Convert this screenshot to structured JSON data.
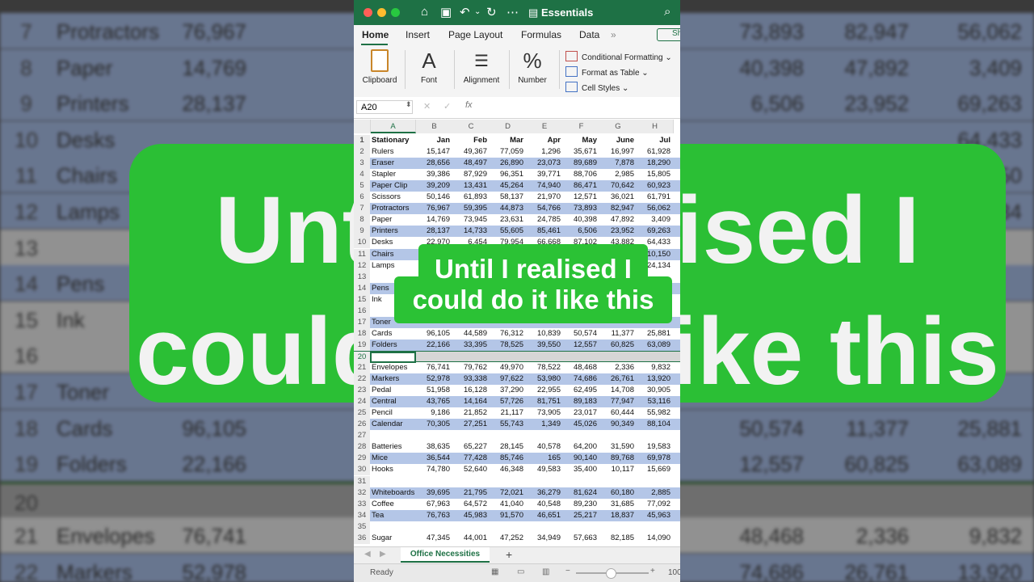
{
  "background": {
    "rows": [
      {
        "num": "7",
        "name": "Protractors",
        "v1": "76,967",
        "v2": "73,893",
        "v3": "82,947",
        "v4": "56,062",
        "style": "alt"
      },
      {
        "num": "8",
        "name": "Paper",
        "v1": "14,769",
        "v2": "40,398",
        "v3": "47,892",
        "v4": "3,409",
        "style": "alt"
      },
      {
        "num": "9",
        "name": "Printers",
        "v1": "28,137",
        "v2": "6,506",
        "v3": "23,952",
        "v4": "69,263",
        "style": "alt"
      },
      {
        "num": "10",
        "name": "Desks",
        "v1": "",
        "v2": "",
        "v3": "",
        "v4": "64,433",
        "style": "alt"
      },
      {
        "num": "11",
        "name": "Chairs",
        "v1": "",
        "v2": "",
        "v3": "",
        "v4": "10,150",
        "style": "alt"
      },
      {
        "num": "12",
        "name": "Lamps",
        "v1": "",
        "v2": "",
        "v3": "",
        "v4": "24,134",
        "style": "alt"
      },
      {
        "num": "13",
        "name": "",
        "v1": "",
        "v2": "",
        "v3": "",
        "v4": "",
        "style": "plain"
      },
      {
        "num": "14",
        "name": "Pens",
        "v1": "",
        "v2": "",
        "v3": "",
        "v4": "",
        "style": "alt"
      },
      {
        "num": "15",
        "name": "Ink",
        "v1": "",
        "v2": "",
        "v3": "",
        "v4": "",
        "style": "plain"
      },
      {
        "num": "16",
        "name": "",
        "v1": "",
        "v2": "",
        "v3": "",
        "v4": "",
        "style": "plain"
      },
      {
        "num": "17",
        "name": "Toner",
        "v1": "",
        "v2": "",
        "v3": "",
        "v4": "",
        "style": "alt"
      },
      {
        "num": "18",
        "name": "Cards",
        "v1": "96,105",
        "v2": "50,574",
        "v3": "11,377",
        "v4": "25,881",
        "style": "alt"
      },
      {
        "num": "19",
        "name": "Folders",
        "v1": "22,166",
        "v2": "12,557",
        "v3": "60,825",
        "v4": "63,089",
        "style": "alt"
      },
      {
        "num": "20",
        "name": "",
        "v1": "",
        "v2": "",
        "v3": "",
        "v4": "",
        "style": "sel"
      },
      {
        "num": "21",
        "name": "Envelopes",
        "v1": "76,741",
        "v2": "48,468",
        "v3": "2,336",
        "v4": "9,832",
        "style": "plain"
      },
      {
        "num": "22",
        "name": "Markers",
        "v1": "52,978",
        "v2": "74,686",
        "v3": "26,761",
        "v4": "13,920",
        "style": "alt"
      }
    ],
    "banner_text": "Until I realised I could do it like this"
  },
  "titlebar": {
    "title": "Essentials",
    "dot_colors": [
      "#ff5f57",
      "#febc2e",
      "#28c840"
    ]
  },
  "tabs": {
    "home": "Home",
    "insert": "Insert",
    "page_layout": "Page Layout",
    "formulas": "Formulas",
    "data": "Data",
    "more": "»",
    "share": "Sh"
  },
  "ribbon": {
    "clipboard": "Clipboard",
    "font": "Font",
    "alignment": "Alignment",
    "number": "Number",
    "conditional_formatting": "Conditional Formatting",
    "format_as_table": "Format as Table",
    "cell_styles": "Cell Styles"
  },
  "formula_bar": {
    "name_box": "A20",
    "fx": "fx"
  },
  "sheet": {
    "columns": [
      "A",
      "B",
      "C",
      "D",
      "E",
      "F",
      "G",
      "H"
    ],
    "rows": [
      {
        "n": "1",
        "cells": [
          "Stationary",
          "Jan",
          "Feb",
          "Mar",
          "Apr",
          "May",
          "June",
          "Jul"
        ],
        "style": "head"
      },
      {
        "n": "2",
        "cells": [
          "Rulers",
          "15,147",
          "49,367",
          "77,059",
          "1,296",
          "35,671",
          "16,997",
          "61,928"
        ],
        "style": "plain"
      },
      {
        "n": "3",
        "cells": [
          "Eraser",
          "28,656",
          "48,497",
          "26,890",
          "23,073",
          "89,689",
          "7,878",
          "18,290"
        ],
        "style": "band"
      },
      {
        "n": "4",
        "cells": [
          "Stapler",
          "39,386",
          "87,929",
          "96,351",
          "39,771",
          "88,706",
          "2,985",
          "15,805"
        ],
        "style": "plain"
      },
      {
        "n": "5",
        "cells": [
          "Paper Clip",
          "39,209",
          "13,431",
          "45,264",
          "74,940",
          "86,471",
          "70,642",
          "60,923"
        ],
        "style": "band"
      },
      {
        "n": "6",
        "cells": [
          "Scissors",
          "50,146",
          "61,893",
          "58,137",
          "21,970",
          "12,571",
          "36,021",
          "61,791"
        ],
        "style": "plain"
      },
      {
        "n": "7",
        "cells": [
          "Protractors",
          "76,967",
          "59,395",
          "44,873",
          "54,766",
          "73,893",
          "82,947",
          "56,062"
        ],
        "style": "band"
      },
      {
        "n": "8",
        "cells": [
          "Paper",
          "14,769",
          "73,945",
          "23,631",
          "24,785",
          "40,398",
          "47,892",
          "3,409"
        ],
        "style": "plain"
      },
      {
        "n": "9",
        "cells": [
          "Printers",
          "28,137",
          "14,733",
          "55,605",
          "85,461",
          "6,506",
          "23,952",
          "69,263"
        ],
        "style": "band"
      },
      {
        "n": "10",
        "cells": [
          "Desks",
          "22,970",
          "6,454",
          "79,954",
          "66,668",
          "87,102",
          "43,882",
          "64,433"
        ],
        "style": "plain"
      },
      {
        "n": "11",
        "cells": [
          "Chairs",
          "",
          "",
          "",
          "",
          "",
          "",
          "10,150"
        ],
        "style": "band"
      },
      {
        "n": "12",
        "cells": [
          "Lamps",
          "",
          "",
          "",
          "",
          "",
          "",
          "24,134"
        ],
        "style": "plain"
      },
      {
        "n": "13",
        "cells": [
          "",
          "",
          "",
          "",
          "",
          "",
          "",
          ""
        ],
        "style": "plain"
      },
      {
        "n": "14",
        "cells": [
          "Pens",
          "",
          "",
          "",
          "",
          "",
          "",
          ""
        ],
        "style": "band"
      },
      {
        "n": "15",
        "cells": [
          "Ink",
          "",
          "",
          "",
          "",
          "",
          "",
          ""
        ],
        "style": "plain"
      },
      {
        "n": "16",
        "cells": [
          "",
          "",
          "",
          "",
          "",
          "",
          "",
          ""
        ],
        "style": "plain"
      },
      {
        "n": "17",
        "cells": [
          "Toner",
          "",
          "",
          "",
          "",
          "",
          "",
          ""
        ],
        "style": "band"
      },
      {
        "n": "18",
        "cells": [
          "Cards",
          "96,105",
          "44,589",
          "76,312",
          "10,839",
          "50,574",
          "11,377",
          "25,881"
        ],
        "style": "plain"
      },
      {
        "n": "19",
        "cells": [
          "Folders",
          "22,166",
          "33,395",
          "78,525",
          "39,550",
          "12,557",
          "60,825",
          "63,089"
        ],
        "style": "band"
      },
      {
        "n": "20",
        "cells": [
          "",
          "",
          "",
          "",
          "",
          "",
          "",
          ""
        ],
        "style": "sel"
      },
      {
        "n": "21",
        "cells": [
          "Envelopes",
          "76,741",
          "79,762",
          "49,970",
          "78,522",
          "48,468",
          "2,336",
          "9,832"
        ],
        "style": "plain"
      },
      {
        "n": "22",
        "cells": [
          "Markers",
          "52,978",
          "93,338",
          "97,622",
          "53,980",
          "74,686",
          "26,761",
          "13,920"
        ],
        "style": "band"
      },
      {
        "n": "23",
        "cells": [
          "Pedal",
          "51,958",
          "16,128",
          "37,290",
          "22,955",
          "62,495",
          "14,708",
          "30,905"
        ],
        "style": "plain"
      },
      {
        "n": "24",
        "cells": [
          "Central",
          "43,765",
          "14,164",
          "57,726",
          "81,751",
          "89,183",
          "77,947",
          "53,116"
        ],
        "style": "band"
      },
      {
        "n": "25",
        "cells": [
          "Pencil",
          "9,186",
          "21,852",
          "21,117",
          "73,905",
          "23,017",
          "60,444",
          "55,982"
        ],
        "style": "plain"
      },
      {
        "n": "26",
        "cells": [
          "Calendar",
          "70,305",
          "27,251",
          "55,743",
          "1,349",
          "45,026",
          "90,349",
          "88,104"
        ],
        "style": "band"
      },
      {
        "n": "27",
        "cells": [
          "",
          "",
          "",
          "",
          "",
          "",
          "",
          ""
        ],
        "style": "plain"
      },
      {
        "n": "28",
        "cells": [
          "Batteries",
          "38,635",
          "65,227",
          "28,145",
          "40,578",
          "64,200",
          "31,590",
          "19,583"
        ],
        "style": "plain"
      },
      {
        "n": "29",
        "cells": [
          "Mice",
          "36,544",
          "77,428",
          "85,746",
          "165",
          "90,140",
          "89,768",
          "69,978"
        ],
        "style": "band"
      },
      {
        "n": "30",
        "cells": [
          "Hooks",
          "74,780",
          "52,640",
          "46,348",
          "49,583",
          "35,400",
          "10,117",
          "15,669"
        ],
        "style": "plain"
      },
      {
        "n": "31",
        "cells": [
          "",
          "",
          "",
          "",
          "",
          "",
          "",
          ""
        ],
        "style": "plain"
      },
      {
        "n": "32",
        "cells": [
          "Whiteboards",
          "39,695",
          "21,795",
          "72,021",
          "36,279",
          "81,624",
          "60,180",
          "2,885"
        ],
        "style": "band"
      },
      {
        "n": "33",
        "cells": [
          "Coffee",
          "67,963",
          "64,572",
          "41,040",
          "40,548",
          "89,230",
          "31,685",
          "77,092"
        ],
        "style": "plain"
      },
      {
        "n": "34",
        "cells": [
          "Tea",
          "76,763",
          "45,983",
          "91,570",
          "46,651",
          "25,217",
          "18,837",
          "45,963"
        ],
        "style": "band"
      },
      {
        "n": "35",
        "cells": [
          "",
          "",
          "",
          "",
          "",
          "",
          "",
          ""
        ],
        "style": "plain"
      },
      {
        "n": "36",
        "cells": [
          "Sugar",
          "47,345",
          "44,001",
          "47,252",
          "34,949",
          "57,663",
          "82,185",
          "14,090"
        ],
        "style": "plain"
      }
    ]
  },
  "sheet_tabs": {
    "active": "Office Necessities",
    "add": "+"
  },
  "status": {
    "ready": "Ready",
    "zoom": "100"
  },
  "overlay": {
    "line1": "Until I realised I",
    "line2": "could do it like this"
  }
}
